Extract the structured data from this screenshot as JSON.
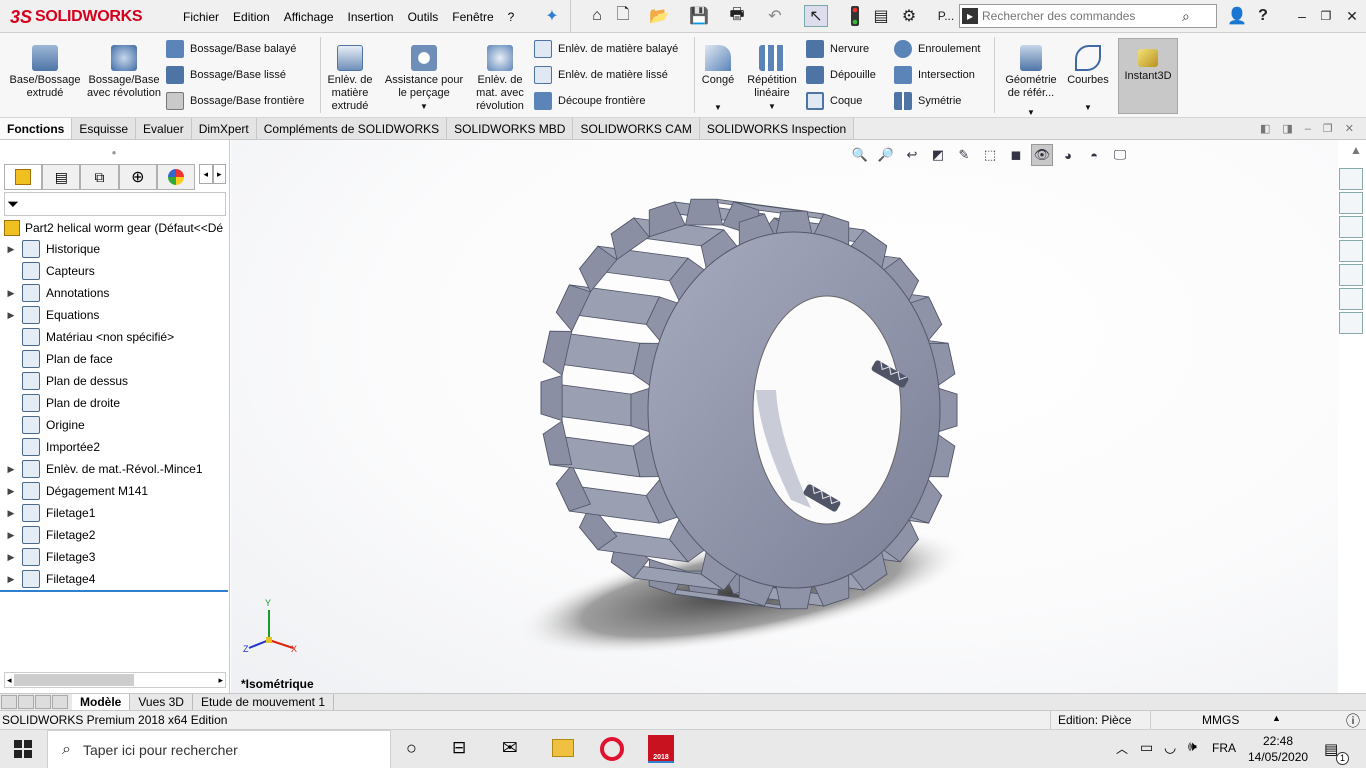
{
  "app": {
    "brand": "SOLIDWORKS",
    "logo_mark": "3S"
  },
  "menu": [
    "Fichier",
    "Edition",
    "Affichage",
    "Insertion",
    "Outils",
    "Fenêtre",
    "?"
  ],
  "quick_access": {
    "extra_label": "P..."
  },
  "search": {
    "placeholder": "Rechercher des commandes"
  },
  "ribbon": {
    "big": [
      {
        "label": "Base/Bossage extrudé"
      },
      {
        "label": "Bossage/Base avec révolution"
      },
      {
        "label": "Enlèv. de matière extrudé"
      },
      {
        "label": "Assistance pour le perçage"
      },
      {
        "label": "Enlèv. de mat. avec révolution"
      },
      {
        "label": "Congé"
      },
      {
        "label": "Répétition linéaire"
      },
      {
        "label": "Géométrie de référ..."
      },
      {
        "label": "Courbes"
      },
      {
        "label": "Instant3D"
      }
    ],
    "small": [
      {
        "label": "Bossage/Base balayé"
      },
      {
        "label": "Bossage/Base lissé"
      },
      {
        "label": "Bossage/Base frontière"
      },
      {
        "label": "Enlèv. de matière balayé"
      },
      {
        "label": "Enlèv. de matière lissé"
      },
      {
        "label": "Découpe frontière"
      },
      {
        "label": "Nervure"
      },
      {
        "label": "Dépouille"
      },
      {
        "label": "Coque"
      },
      {
        "label": "Enroulement"
      },
      {
        "label": "Intersection"
      },
      {
        "label": "Symétrie"
      }
    ]
  },
  "command_tabs": [
    "Fonctions",
    "Esquisse",
    "Evaluer",
    "DimXpert",
    "Compléments de SOLIDWORKS",
    "SOLIDWORKS MBD",
    "SOLIDWORKS CAM",
    "SOLIDWORKS Inspection"
  ],
  "tree": {
    "root": "Part2 helical worm gear  (Défaut<<Dé",
    "items": [
      {
        "label": "Historique",
        "expandable": true
      },
      {
        "label": "Capteurs",
        "expandable": false
      },
      {
        "label": "Annotations",
        "expandable": true
      },
      {
        "label": "Equations",
        "expandable": true
      },
      {
        "label": "Matériau <non spécifié>",
        "expandable": false
      },
      {
        "label": "Plan de face",
        "expandable": false
      },
      {
        "label": "Plan de dessus",
        "expandable": false
      },
      {
        "label": "Plan de droite",
        "expandable": false
      },
      {
        "label": "Origine",
        "expandable": false
      },
      {
        "label": "Importée2",
        "expandable": false
      },
      {
        "label": "Enlèv. de mat.-Révol.-Mince1",
        "expandable": true
      },
      {
        "label": "Dégagement M141",
        "expandable": true
      },
      {
        "label": "Filetage1",
        "expandable": true
      },
      {
        "label": "Filetage2",
        "expandable": true
      },
      {
        "label": "Filetage3",
        "expandable": true
      },
      {
        "label": "Filetage4",
        "expandable": true
      }
    ]
  },
  "viewport": {
    "view_label": "*Isométrique",
    "axes": {
      "x": "X",
      "y": "Y",
      "z": "Z"
    }
  },
  "bottom_tabs": [
    "Modèle",
    "Vues 3D",
    "Etude de mouvement 1"
  ],
  "status": {
    "edition": "SOLIDWORKS Premium 2018 x64 Edition",
    "mode": "Edition: Pièce",
    "units": "MMGS"
  },
  "taskbar": {
    "search_placeholder": "Taper ici pour rechercher",
    "lang": "FRA",
    "time": "22:48",
    "date": "14/05/2020",
    "notif": "1",
    "sw_badge": "2018"
  },
  "colors": {
    "brand_red": "#d6001c",
    "part_gray": "#8e93a8",
    "selection_blue": "#2f7fd0"
  }
}
